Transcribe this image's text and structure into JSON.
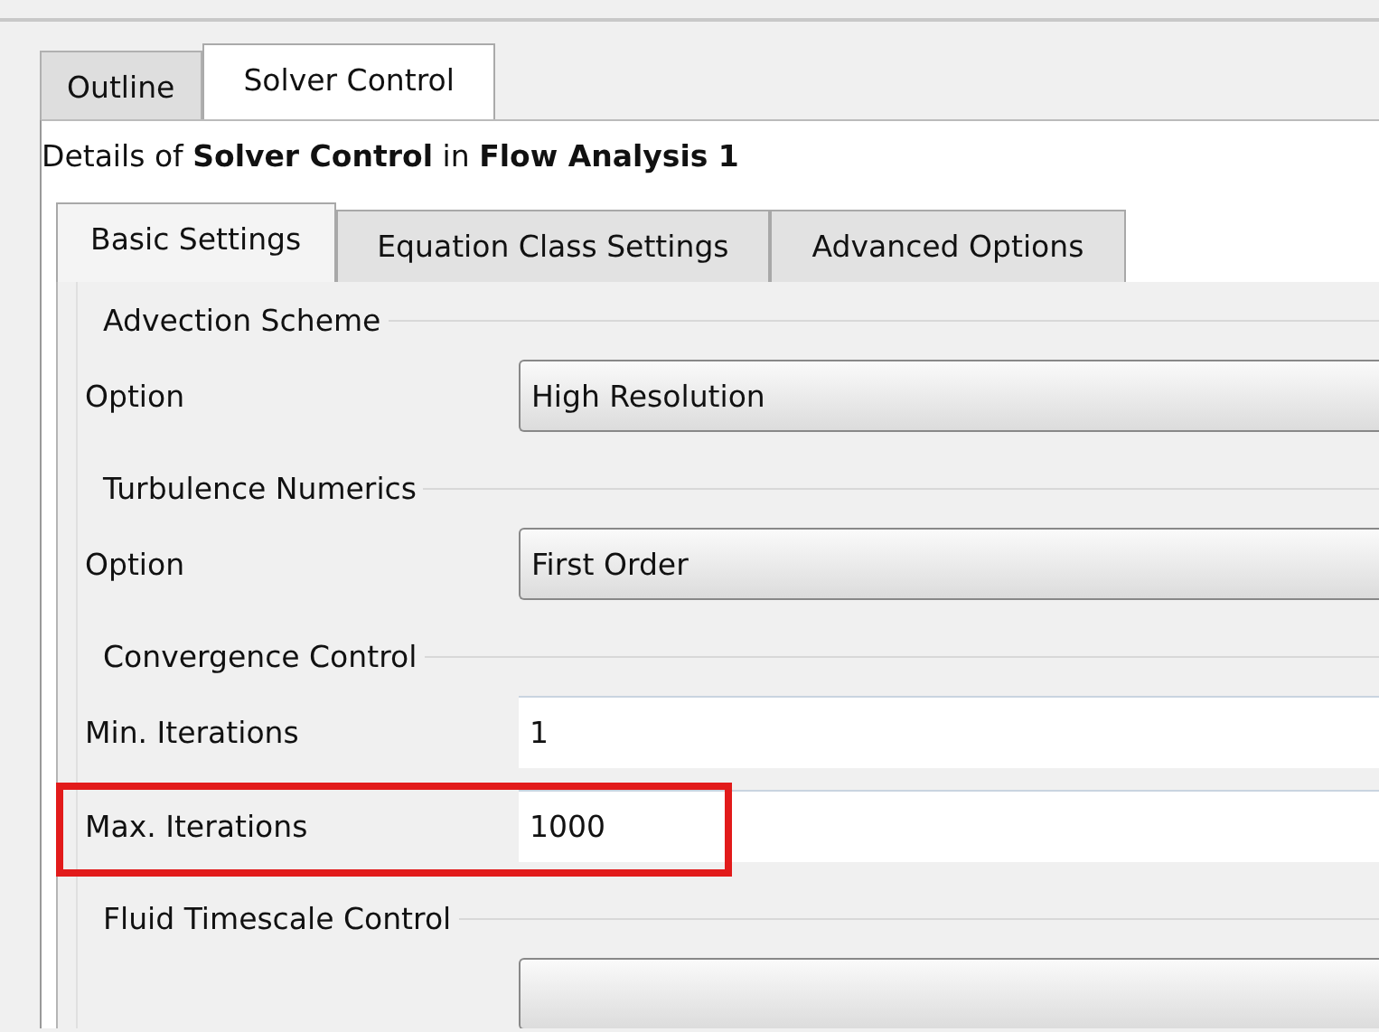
{
  "outer_tabs": [
    {
      "label": "Outline",
      "selected": false
    },
    {
      "label": "Solver Control",
      "selected": true
    }
  ],
  "details_heading": "Details of **Solver Control** in **Flow Analysis 1**",
  "inner_tabs": [
    {
      "label": "Basic Settings",
      "selected": true
    },
    {
      "label": "Equation Class Settings",
      "selected": false
    },
    {
      "label": "Advanced Options",
      "selected": false
    }
  ],
  "groups": [
    {
      "title": "Advection Scheme",
      "rows": [
        {
          "kind": "dropdown",
          "label": "Option",
          "value": "High Resolution",
          "highlighted": false
        }
      ]
    },
    {
      "title": "Turbulence Numerics",
      "rows": [
        {
          "kind": "dropdown",
          "label": "Option",
          "value": "First Order",
          "highlighted": false
        }
      ]
    },
    {
      "title": "Convergence Control",
      "rows": [
        {
          "kind": "number",
          "label": "Min. Iterations",
          "value": "1",
          "highlighted": false
        },
        {
          "kind": "number",
          "label": "Max. Iterations",
          "value": "1000",
          "highlighted": true
        }
      ]
    },
    {
      "title": "Fluid Timescale Control",
      "rows": [
        {
          "kind": "dropdown",
          "highlighted": false
        }
      ]
    }
  ]
}
